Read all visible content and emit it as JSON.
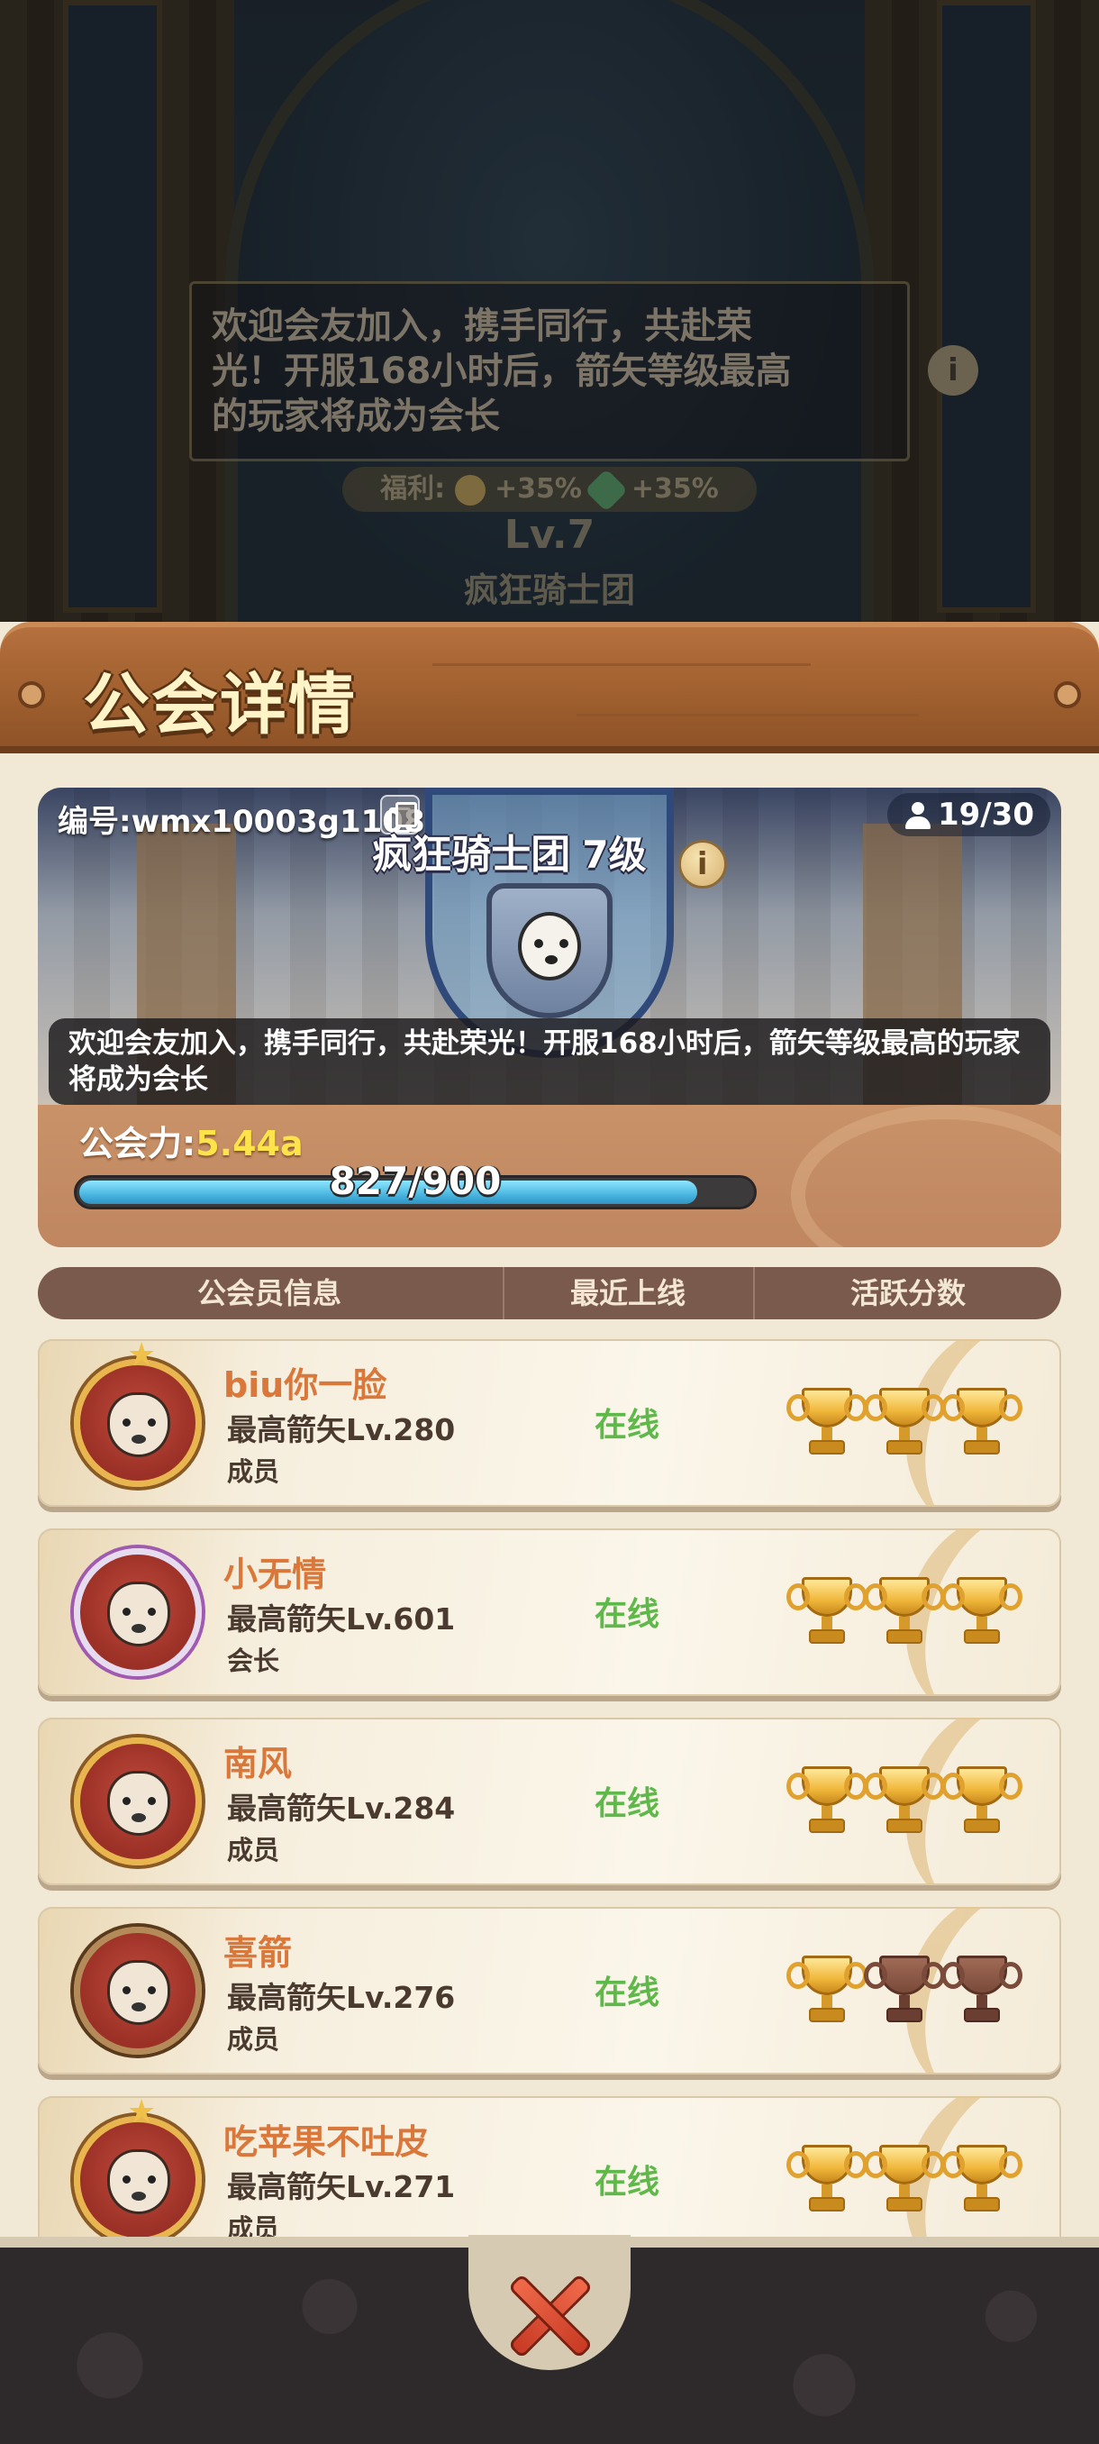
{
  "background": {
    "motto": "欢迎会友加入，携手同行，共赴荣光！开服168小时后，箭矢等级最高的玩家将成为会长",
    "welfare_label": "福利:",
    "welfare_bonus_1": "+35%",
    "welfare_bonus_2": "+35%",
    "level": "Lv.7",
    "guild_name": "疯狂骑士团"
  },
  "panel": {
    "title": "公会详情"
  },
  "guild": {
    "id_label": "编号:wmx10003g1108",
    "members_count": "19/30",
    "name": "疯狂骑士团",
    "level": "7级",
    "info_icon": "i",
    "motto": "欢迎会友加入，携手同行，共赴荣光！开服168小时后，箭矢等级最高的玩家将成为会长",
    "power_label": "公会力:",
    "power_value": "5.44a",
    "progress_text": "827/900",
    "progress_fraction": 0.919
  },
  "table_header": {
    "col_info": "公会员信息",
    "col_last_online": "最近上线",
    "col_activity": "活跃分数"
  },
  "members": [
    {
      "name": "biu你一脸",
      "arrow": "最高箭矢Lv.280",
      "role": "成员",
      "status": "在线",
      "trophies": [
        true,
        true,
        true
      ]
    },
    {
      "name": "小无情",
      "arrow": "最高箭矢Lv.601",
      "role": "会长",
      "status": "在线",
      "trophies": [
        true,
        true,
        true
      ]
    },
    {
      "name": "南风",
      "arrow": "最高箭矢Lv.284",
      "role": "成员",
      "status": "在线",
      "trophies": [
        true,
        true,
        true
      ]
    },
    {
      "name": "喜箭",
      "arrow": "最高箭矢Lv.276",
      "role": "成员",
      "status": "在线",
      "trophies": [
        true,
        false,
        false
      ]
    },
    {
      "name": "吃苹果不吐皮",
      "arrow": "最高箭矢Lv.271",
      "role": "成员",
      "status": "在线",
      "trophies": [
        true,
        true,
        true
      ]
    }
  ],
  "colors": {
    "name_orange": "#d9783a",
    "online_green": "#5fb84a",
    "power_yellow": "#ffe34a",
    "header_wood": "#a1602f"
  }
}
